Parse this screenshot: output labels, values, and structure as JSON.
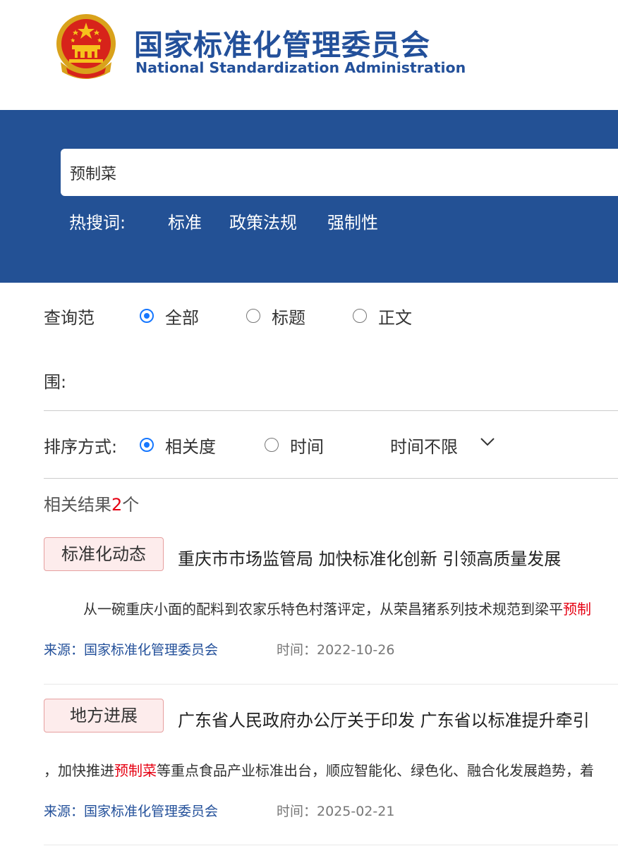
{
  "header": {
    "title_cn": "国家标准化管理委员会",
    "title_en": "National Standardization Administration",
    "emblem_icon": "national-emblem-icon",
    "colors": {
      "brand_blue": "#23509a",
      "band_blue": "#235195",
      "highlight_red": "#e60012",
      "radio_blue": "#1677ff"
    }
  },
  "search": {
    "value": "预制菜",
    "hot_label": "热搜词:",
    "hot_terms": [
      "标准",
      "政策法规",
      "强制性"
    ]
  },
  "filters": {
    "scope_label_1": "查询范",
    "scope_label_2": "围:",
    "scope_options": [
      {
        "label": "全部",
        "selected": true
      },
      {
        "label": "标题",
        "selected": false
      },
      {
        "label": "正文",
        "selected": false
      }
    ],
    "sort_label": "排序方式:",
    "sort_options": [
      {
        "label": "相关度",
        "selected": true
      },
      {
        "label": "时间",
        "selected": false
      }
    ],
    "time_filter": "时间不限",
    "time_filter_icon": "chevron-down-icon"
  },
  "results": {
    "count_prefix": "相关结果",
    "count": "2",
    "count_suffix": "个",
    "items": [
      {
        "tag": "标准化动态",
        "title": "重庆市市场监管局 加快标准化创新 引领高质量发展",
        "snippet_before": "从一碗重庆小面的配料到农家乐特色村落评定，从荣昌猪系列技术规范到梁平",
        "snippet_highlight": "预制",
        "snippet_after": "",
        "source": "来源：国家标准化管理委员会",
        "time": "时间：2022-10-26"
      },
      {
        "tag": "地方进展",
        "title": "广东省人民政府办公厅关于印发 广东省以标准提升牵引",
        "snippet_before": "，加快推进",
        "snippet_highlight": "预制菜",
        "snippet_after": "等重点食品产业标准出台，顺应智能化、绿色化、融合化发展趋势，着",
        "source": "来源：国家标准化管理委员会",
        "time": "时间：2025-02-21"
      }
    ]
  }
}
